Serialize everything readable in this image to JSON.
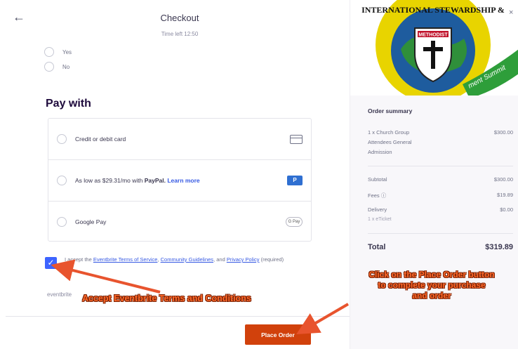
{
  "header": {
    "back_glyph": "←",
    "title": "Checkout",
    "timer": "Time left 12:50"
  },
  "question": {
    "options": [
      "Yes",
      "No"
    ]
  },
  "payment": {
    "heading": "Pay with",
    "options": [
      {
        "label": "Credit or debit card",
        "icon": "credit-card-icon"
      },
      {
        "prefix": "As low as $29.31/mo with ",
        "brand": "PayPal.",
        "link": " Learn more",
        "icon": "paypal-icon",
        "icon_text": "P"
      },
      {
        "label": "Google Pay",
        "icon": "google-pay-icon",
        "icon_text": "G Pay"
      }
    ]
  },
  "terms": {
    "checked": true,
    "checkmark": "✓",
    "text_a": "I accept the ",
    "link_tos": "Eventbrite Terms of Service",
    "sep": ", ",
    "link_cg": "Community Guidelines",
    "text_and": ", and ",
    "link_pp": "Privacy Policy",
    "text_req": " (required)"
  },
  "footer": {
    "logo_text": "eventbrite",
    "place_order_label": "Place Order",
    "button_color": "#d1410c"
  },
  "banner": {
    "top_arc_text": "INTERNATIONAL STEWARDSHIP &",
    "shield_label": "METHODIST",
    "ribbon_text": "ment Summit",
    "close_glyph": "×"
  },
  "order_summary": {
    "title": "Order summary",
    "item": {
      "lines": [
        "1 x Church Group",
        "Attendees General",
        "Admission"
      ],
      "price": "$300.00"
    },
    "subtotal": {
      "label": "Subtotal",
      "value": "$300.00"
    },
    "fees": {
      "label": "Fees ⓘ",
      "value": "$19.89"
    },
    "delivery": {
      "label": "Delivery",
      "value": "$0.00",
      "sub": "1 x eTicket"
    },
    "total": {
      "label": "Total",
      "value": "$319.89"
    }
  },
  "annotations": {
    "terms_note": "Accept Eventbrite Terms and Conditions",
    "place_note_lines": [
      "Click on the Place Order button",
      "to complete your purchase",
      "and order"
    ],
    "annotation_color": "#ff6a2b"
  }
}
